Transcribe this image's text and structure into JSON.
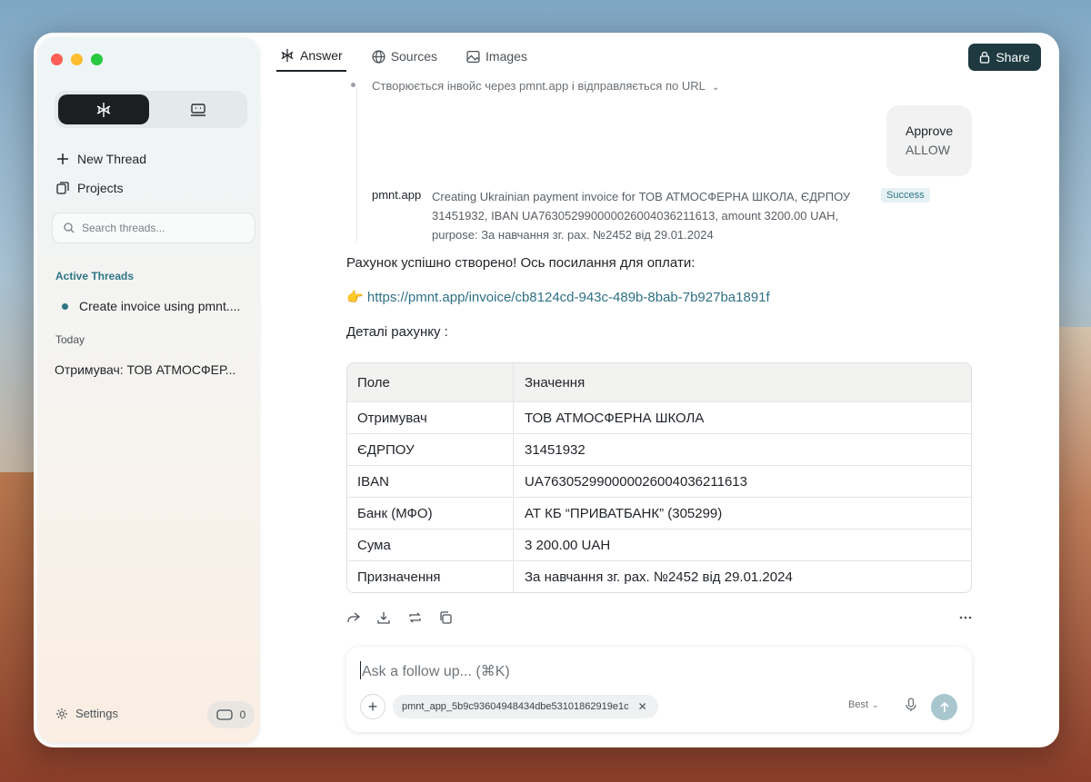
{
  "sidebar": {
    "new_thread_label": "New Thread",
    "projects_label": "Projects",
    "search_placeholder": "Search threads...",
    "active_threads_label": "Active Threads",
    "active_thread_title": "Create invoice using pmnt....",
    "today_label": "Today",
    "today_thread_title": "Отримувач: ТОВ АТМОСФЕР...",
    "settings_label": "Settings",
    "credits_count": "0"
  },
  "tabs": [
    {
      "label": "Answer",
      "icon": "sparkle-icon",
      "active": true
    },
    {
      "label": "Sources",
      "icon": "globe-icon",
      "active": false
    },
    {
      "label": "Images",
      "icon": "image-icon",
      "active": false
    }
  ],
  "header": {
    "share_label": "Share"
  },
  "tool_step": {
    "step_text": "Створюється інвойс через pmnt.app і відправляється по URL",
    "approve_title": "Approve",
    "approve_value": "ALLOW",
    "tool_name": "pmnt.app",
    "tool_description": "Creating Ukrainian payment invoice for ТОВ АТМОСФЕРНА ШКОЛА, ЄДРПОУ 31451932, IBAN UA763052990000026004036211613, amount 3200.00 UAH, purpose: За навчання зг. рах. №2452 від 29.01.2024",
    "status": "Success"
  },
  "answer": {
    "intro": "Рахунок успішно створено! Ось посилання для оплати:",
    "link_emoji": "👉",
    "link_url": "https://pmnt.app/invoice/cb8124cd-943c-489b-8bab-7b927ba1891f",
    "details_heading": "Деталі рахунку :"
  },
  "table": {
    "headers": [
      "Поле",
      "Значення"
    ],
    "rows": [
      [
        "Отримувач",
        "ТОВ АТМОСФЕРНА ШКОЛА"
      ],
      [
        "ЄДРПОУ",
        "31451932"
      ],
      [
        "IBAN",
        "UA763052990000026004036211613"
      ],
      [
        "Банк (МФО)",
        "АТ КБ “ПРИВАТБАНК” (305299)"
      ],
      [
        "Сума",
        "3 200.00 UAH"
      ],
      [
        "Призначення",
        "За навчання зг. рах. №2452 від 29.01.2024"
      ]
    ]
  },
  "composer": {
    "placeholder": "Ask a follow up... (⌘K)",
    "attachment": "pmnt_app_5b9c93604948434dbe53101862919e1c",
    "model": "Best"
  },
  "colors": {
    "accent": "#2e7085",
    "share_bg": "#1e3a40",
    "active_dot": "#2f7686",
    "send_bg": "#a9c6cf"
  }
}
